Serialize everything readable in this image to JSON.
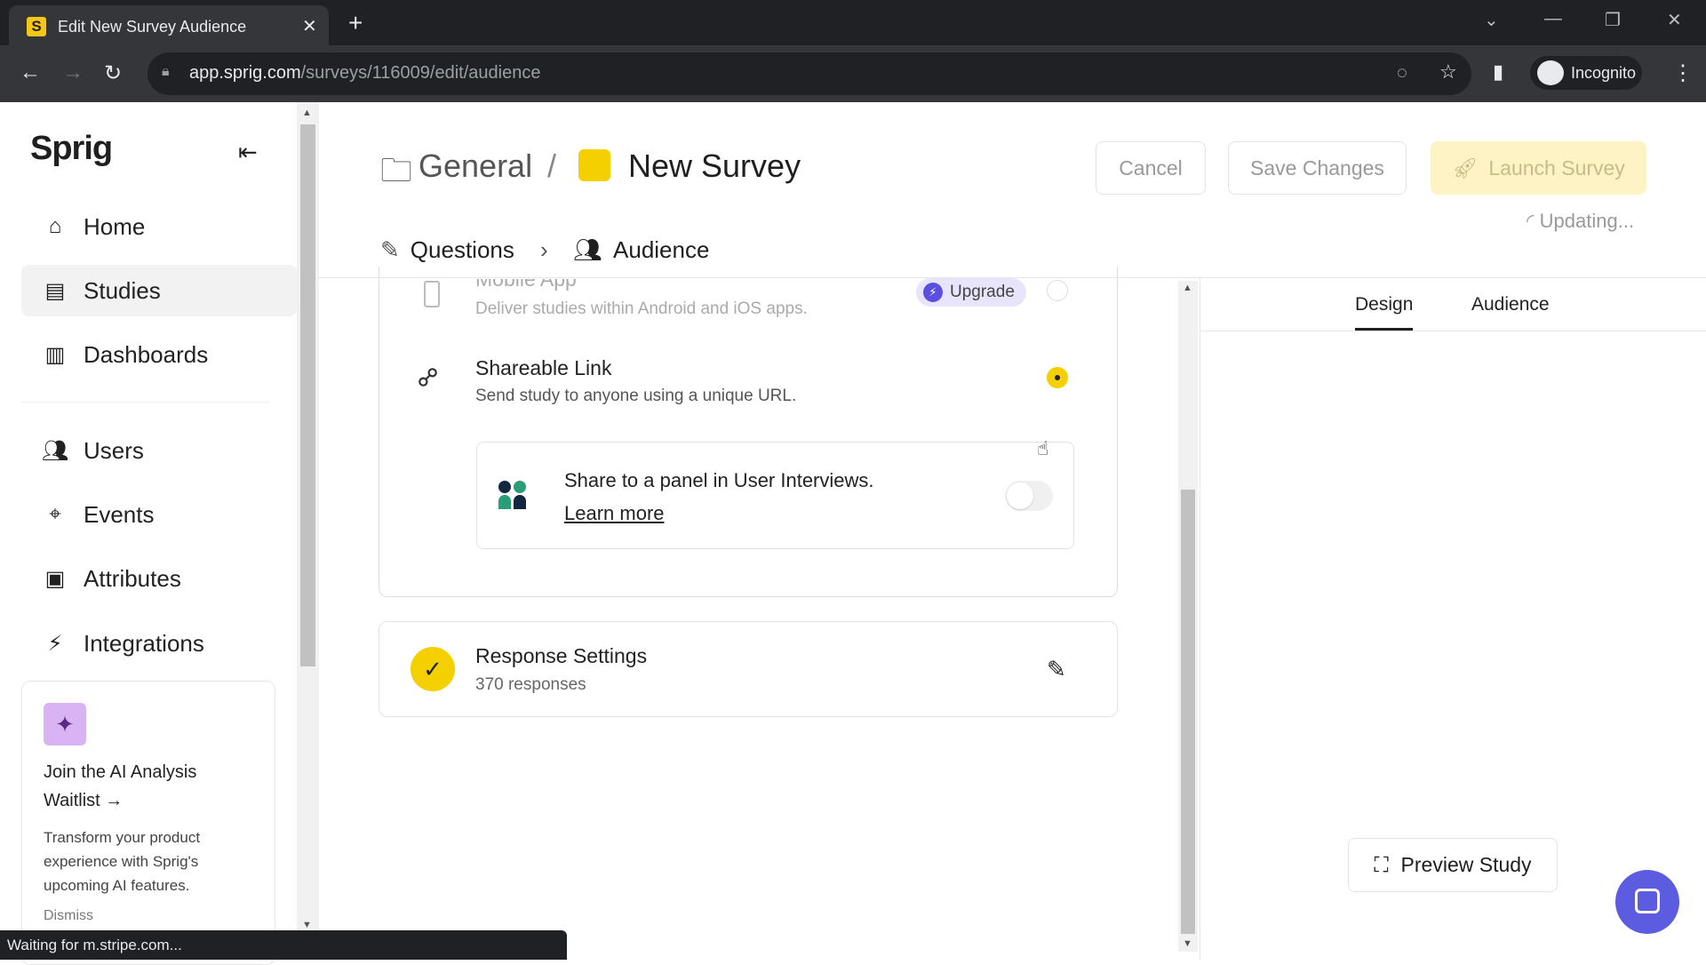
{
  "browser": {
    "tab_title": "Edit New Survey Audience",
    "favicon": "S",
    "url_host": "app.sprig.com",
    "url_path": "/surveys/116009/edit/audience",
    "profile": "Incognito",
    "status": "Waiting for m.stripe.com..."
  },
  "sidebar": {
    "logo": "Sprig",
    "items": [
      {
        "label": "Home",
        "icon": "home-icon"
      },
      {
        "label": "Studies",
        "icon": "studies-icon",
        "active": true
      },
      {
        "label": "Dashboards",
        "icon": "dashboard-icon"
      },
      {
        "label": "Users",
        "icon": "users-icon"
      },
      {
        "label": "Events",
        "icon": "events-icon"
      },
      {
        "label": "Attributes",
        "icon": "attributes-icon"
      },
      {
        "label": "Integrations",
        "icon": "integrations-icon"
      }
    ],
    "promo": {
      "title": "Join the AI Analysis Waitlist →",
      "desc": "Transform your product experience with Sprig's upcoming AI features.",
      "dismiss": "Dismiss"
    }
  },
  "header": {
    "folder": "General",
    "separator": "/",
    "survey": "New Survey",
    "cancel": "Cancel",
    "save": "Save Changes",
    "launch": "Launch Survey",
    "updating": "Updating..."
  },
  "tabs": {
    "questions": "Questions",
    "audience": "Audience"
  },
  "platforms": {
    "mobile": {
      "title": "Mobile App",
      "desc": "Deliver studies within Android and iOS apps.",
      "badge": "Upgrade"
    },
    "link": {
      "title": "Shareable Link",
      "desc": "Send study to anyone using a unique URL.",
      "selected": true
    },
    "panel": {
      "text": "Share to a panel in User Interviews.",
      "link": "Learn more",
      "enabled": false
    }
  },
  "response": {
    "title": "Response Settings",
    "count": "370 responses"
  },
  "right": {
    "tabs": [
      "Design",
      "Audience"
    ],
    "preview": "Preview Study"
  },
  "colors": {
    "accent": "#f5d000",
    "upgrade": "#5b4fe0",
    "chat": "#5b5ce0"
  }
}
